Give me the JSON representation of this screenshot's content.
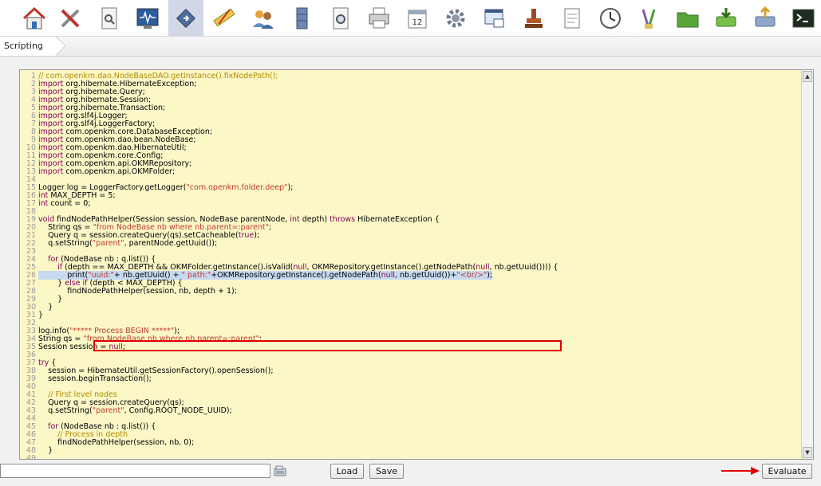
{
  "toolbar": {
    "items": [
      {
        "icon": "home-icon"
      },
      {
        "icon": "tools-icon"
      },
      {
        "icon": "document-view-icon"
      },
      {
        "icon": "monitor-icon"
      },
      {
        "icon": "scripting-icon",
        "active": true
      },
      {
        "icon": "ruler-icon"
      },
      {
        "icon": "users-icon"
      },
      {
        "icon": "file-cabinet-icon"
      },
      {
        "icon": "search-document-icon"
      },
      {
        "icon": "printer-icon"
      },
      {
        "icon": "calendar-icon"
      },
      {
        "icon": "gear-icon"
      },
      {
        "icon": "window-icon"
      },
      {
        "icon": "stamp-icon"
      },
      {
        "icon": "notes-icon"
      },
      {
        "icon": "clock-icon"
      },
      {
        "icon": "paint-icon"
      },
      {
        "icon": "folder-icon"
      },
      {
        "icon": "import-icon"
      },
      {
        "icon": "export-icon"
      },
      {
        "icon": "terminal-icon"
      }
    ]
  },
  "tab": {
    "label": "Scripting"
  },
  "editor": {
    "lines": [
      "<span class=\"c\">// com.openkm.dao.NodeBaseDAO.getInstance().fixNodePath();</span>",
      "<span class=\"k\">import</span> org.hibernate.HibernateException;",
      "<span class=\"k\">import</span> org.hibernate.Query;",
      "<span class=\"k\">import</span> org.hibernate.Session;",
      "<span class=\"k\">import</span> org.hibernate.Transaction;",
      "<span class=\"k\">import</span> org.slf4j.Logger;",
      "<span class=\"k\">import</span> org.slf4j.LoggerFactory;",
      "<span class=\"k\">import</span> com.openkm.core.DatabaseException;",
      "<span class=\"k\">import</span> com.openkm.dao.bean.NodeBase;",
      "<span class=\"k\">import</span> com.openkm.dao.HibernateUtil;",
      "<span class=\"k\">import</span> com.openkm.core.Config;",
      "<span class=\"k\">import</span> com.openkm.api.OKMRepository;",
      "<span class=\"k\">import</span> com.openkm.api.OKMFolder;",
      "",
      "Logger log = LoggerFactory.getLogger(<span class=\"s\">\"com.openkm.folder.deep\"</span>);",
      "<span class=\"k\">int</span> MAX_DEPTH = 5;",
      "<span class=\"k\">int</span> count = 0;",
      "",
      "<span class=\"k\">void</span> findNodePathHelper(Session session, NodeBase parentNode, <span class=\"k\">int</span> depth) <span class=\"k\">throws</span> HibernateException {",
      "    String qs = <span class=\"s\">\"from NodeBase nb where nb.parent=:parent\"</span>;",
      "    Query q = session.createQuery(qs).setCacheable(<span class=\"k\">true</span>);",
      "    q.setString(<span class=\"s\">\"parent\"</span>, parentNode.getUuid());",
      "",
      "    <span class=\"k\">for</span> (NodeBase nb : q.list()) {",
      "        <span class=\"k\">if</span> (depth == MAX_DEPTH &amp;&amp; OKMFolder.getInstance().isValid(<span class=\"k\">null</span>, OKMRepository.getInstance().getNodePath(<span class=\"k\">null</span>, nb.getUuid()))) {",
      "            print(<span class=\"s\">\"uuid:\"</span>+ nb.getUuid() + <span class=\"s\">\" path:\"</span>+OKMRepository.getInstance().getNodePath(<span class=\"k\">null</span>, nb.getUuid())+<span class=\"s\">\"&lt;br/&gt;\"</span>);",
      "        } <span class=\"k\">else if</span> (depth &lt; MAX_DEPTH) {",
      "            findNodePathHelper(session, nb, depth + 1);",
      "        }",
      "    }",
      "}",
      "",
      "log.info(<span class=\"s\">\"***** Process BEGIN *****\"</span>);",
      "String qs = <span class=\"s\">\"from NodeBase nb where nb.parent=:parent\"</span>;",
      "Session session = <span class=\"k\">null</span>;",
      "",
      "<span class=\"k\">try</span> {",
      "    session = HibernateUtil.getSessionFactory().openSession();",
      "    session.beginTransaction();",
      "",
      "    <span class=\"c\">// First level nodes</span>",
      "    Query q = session.createQuery(qs);",
      "    q.setString(<span class=\"s\">\"parent\"</span>, Config.ROOT_NODE_UUID);",
      "",
      "    <span class=\"k\">for</span> (NodeBase nb : q.list()) {",
      "        <span class=\"c\">// Process in depth</span>",
      "        findNodePathHelper(session, nb, 0);",
      "    }",
      ""
    ],
    "highlighted_line": 26
  },
  "bottom": {
    "script_file_value": "",
    "load_label": "Load",
    "save_label": "Save",
    "evaluate_label": "Evaluate"
  }
}
